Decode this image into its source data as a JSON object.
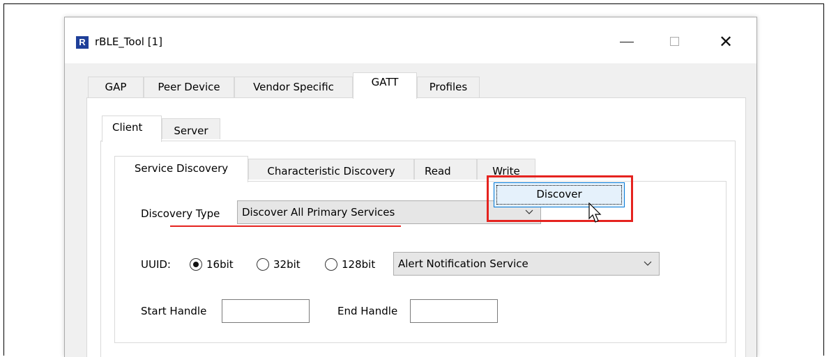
{
  "window": {
    "title": "rBLE_Tool [1]",
    "logo_letter": "R",
    "close_glyph": "✕"
  },
  "main_tabs": [
    {
      "label": "GAP"
    },
    {
      "label": "Peer Device"
    },
    {
      "label": "Vendor Specific"
    },
    {
      "label": "GATT",
      "active": true
    },
    {
      "label": "Profiles"
    }
  ],
  "sub_tabs": [
    {
      "label": "Client",
      "active": true
    },
    {
      "label": "Server"
    }
  ],
  "client_tabs": [
    {
      "label": "Service Discovery",
      "active": true
    },
    {
      "label": "Characteristic Discovery"
    },
    {
      "label": "Read"
    },
    {
      "label": "Write"
    }
  ],
  "discovery": {
    "type_label": "Discovery Type",
    "type_value": "Discover All Primary Services",
    "button_label": "Discover"
  },
  "uuid": {
    "label": "UUID:",
    "options": [
      {
        "label": "16bit",
        "checked": true
      },
      {
        "label": "32bit",
        "checked": false
      },
      {
        "label": "128bit",
        "checked": false
      }
    ],
    "service_value": "Alert Notification Service"
  },
  "handles": {
    "start_label": "Start Handle",
    "start_value": "",
    "end_label": "End Handle",
    "end_value": ""
  },
  "colors": {
    "highlight": "#e5231f",
    "logo": "#1e3f99"
  },
  "icons": {
    "chevron": "chevron-down-icon",
    "cursor": "mouse-pointer-icon"
  }
}
